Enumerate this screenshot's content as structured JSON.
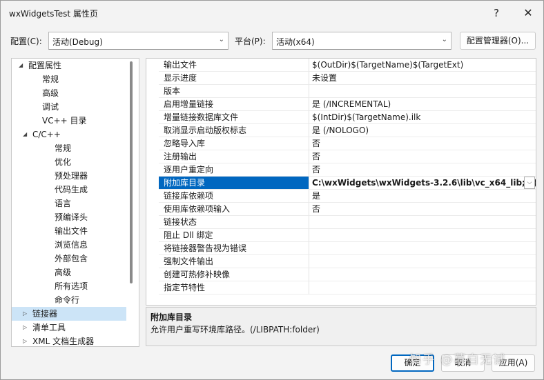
{
  "window": {
    "title": "wxWidgetsTest 属性页",
    "help_label": "?",
    "close_label": "✕"
  },
  "toolbar": {
    "config_label": "配置(C):",
    "config_value": "活动(Debug)",
    "platform_label": "平台(P):",
    "platform_value": "活动(x64)",
    "manager_label": "配置管理器(O)..."
  },
  "tree": {
    "items": [
      {
        "label": "配置属性",
        "twisty": "expanded"
      },
      {
        "label": "常规",
        "twisty": ""
      },
      {
        "label": "高级",
        "twisty": ""
      },
      {
        "label": "调试",
        "twisty": ""
      },
      {
        "label": "VC++ 目录",
        "twisty": ""
      },
      {
        "label": "C/C++",
        "twisty": "expanded"
      },
      {
        "label": "常规",
        "twisty": ""
      },
      {
        "label": "优化",
        "twisty": ""
      },
      {
        "label": "预处理器",
        "twisty": ""
      },
      {
        "label": "代码生成",
        "twisty": ""
      },
      {
        "label": "语言",
        "twisty": ""
      },
      {
        "label": "预编译头",
        "twisty": ""
      },
      {
        "label": "输出文件",
        "twisty": ""
      },
      {
        "label": "浏览信息",
        "twisty": ""
      },
      {
        "label": "外部包含",
        "twisty": ""
      },
      {
        "label": "高级",
        "twisty": ""
      },
      {
        "label": "所有选项",
        "twisty": ""
      },
      {
        "label": "命令行",
        "twisty": ""
      },
      {
        "label": "链接器",
        "twisty": "collapsed",
        "selected": true
      },
      {
        "label": "清单工具",
        "twisty": "collapsed"
      },
      {
        "label": "XML 文档生成器",
        "twisty": "collapsed"
      }
    ]
  },
  "grid": {
    "rows": [
      {
        "name": "输出文件",
        "value": "$(OutDir)$(TargetName)$(TargetExt)"
      },
      {
        "name": "显示进度",
        "value": "未设置"
      },
      {
        "name": "版本",
        "value": ""
      },
      {
        "name": "启用增量链接",
        "value": "是 (/INCREMENTAL)"
      },
      {
        "name": "增量链接数据库文件",
        "value": "$(IntDir)$(TargetName).ilk"
      },
      {
        "name": "取消显示启动版权标志",
        "value": "是 (/NOLOGO)"
      },
      {
        "name": "忽略导入库",
        "value": "否"
      },
      {
        "name": "注册输出",
        "value": "否"
      },
      {
        "name": "逐用户重定向",
        "value": "否"
      },
      {
        "name": "附加库目录",
        "value": "C:\\wxWidgets\\wxWidgets-3.2.6\\lib\\vc_x64_lib;%(A",
        "selected": true
      },
      {
        "name": "链接库依赖项",
        "value": "是"
      },
      {
        "name": "使用库依赖项输入",
        "value": "否"
      },
      {
        "name": "链接状态",
        "value": ""
      },
      {
        "name": "阻止 Dll 绑定",
        "value": ""
      },
      {
        "name": "将链接器警告视为错误",
        "value": ""
      },
      {
        "name": "强制文件输出",
        "value": ""
      },
      {
        "name": "创建可热修补映像",
        "value": ""
      },
      {
        "name": "指定节特性",
        "value": ""
      }
    ]
  },
  "description": {
    "title": "附加库目录",
    "text": "允许用户重写环境库路径。(/LIBPATH:folder)"
  },
  "buttons": {
    "ok": "确定",
    "cancel": "取消",
    "apply": "应用(A)"
  },
  "watermark": "知乎 @慕白无诚",
  "colors": {
    "selection_blue": "#0067c0",
    "tree_selection": "#cce4f7"
  }
}
